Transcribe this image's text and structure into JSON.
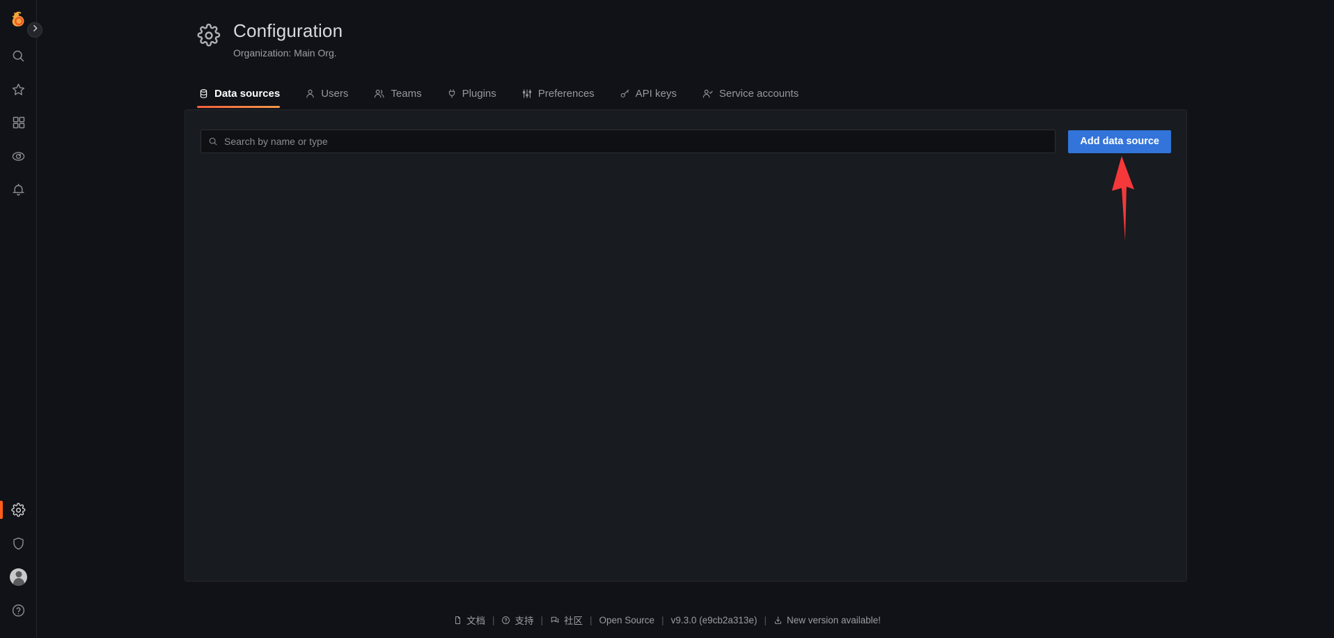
{
  "colors": {
    "page_bg": "#111217",
    "panel_bg": "#181b1f",
    "accent_orange": "#ff5e1a",
    "primary_blue": "#3274d9",
    "annotation_red": "#f5383a",
    "text_primary": "#d8dae0",
    "text_muted": "#9698a0"
  },
  "sidenav": {
    "logo_icon": "grafana-logo-icon",
    "expand_toggle": {
      "icon": "chevron-right-icon",
      "label": "Expand navigation"
    },
    "top_items": [
      {
        "icon": "search-icon",
        "name": "sidebar-item-search",
        "active": false
      },
      {
        "icon": "star-icon",
        "name": "sidebar-item-starred",
        "active": false
      },
      {
        "icon": "dashboards-icon",
        "name": "sidebar-item-dashboards",
        "active": false
      },
      {
        "icon": "compass-icon",
        "name": "sidebar-item-explore",
        "active": false
      },
      {
        "icon": "bell-icon",
        "name": "sidebar-item-alerting",
        "active": false
      }
    ],
    "bottom_items": [
      {
        "icon": "gear-icon",
        "name": "sidebar-item-configuration",
        "active": true
      },
      {
        "icon": "shield-icon",
        "name": "sidebar-item-server-admin",
        "active": false
      },
      {
        "icon": "avatar-icon",
        "name": "sidebar-item-user-profile",
        "active": false
      },
      {
        "icon": "help-circle-icon",
        "name": "sidebar-item-help",
        "active": false
      }
    ]
  },
  "header": {
    "icon": "gear-icon",
    "title": "Configuration",
    "subtitle": "Organization: Main Org."
  },
  "tabs": [
    {
      "label": "Data sources",
      "icon": "database-icon",
      "name": "tab-data-sources",
      "active": true
    },
    {
      "label": "Users",
      "icon": "user-icon",
      "name": "tab-users",
      "active": false
    },
    {
      "label": "Teams",
      "icon": "users-icon",
      "name": "tab-teams",
      "active": false
    },
    {
      "label": "Plugins",
      "icon": "plug-icon",
      "name": "tab-plugins",
      "active": false
    },
    {
      "label": "Preferences",
      "icon": "sliders-icon",
      "name": "tab-preferences",
      "active": false
    },
    {
      "label": "API keys",
      "icon": "key-icon",
      "name": "tab-api-keys",
      "active": false
    },
    {
      "label": "Service accounts",
      "icon": "user-check-icon",
      "name": "tab-service-accounts",
      "active": false
    }
  ],
  "toolbar": {
    "search": {
      "icon": "search-icon",
      "placeholder": "Search by name or type",
      "value": ""
    },
    "add_button_label": "Add data source"
  },
  "datasources_list": {
    "items": [],
    "empty": true
  },
  "annotation": {
    "type": "arrow",
    "color": "#f5383a",
    "points_to": "add-data-source-button"
  },
  "footer": {
    "items": [
      {
        "label": "文档",
        "icon": "document-icon",
        "name": "footer-link-docs"
      },
      {
        "label": "支持",
        "icon": "question-circle-icon",
        "name": "footer-link-support"
      },
      {
        "label": "社区",
        "icon": "comments-icon",
        "name": "footer-link-community"
      },
      {
        "label": "Open Source",
        "icon": "",
        "name": "footer-link-open-source"
      },
      {
        "label": "v9.3.0 (e9cb2a313e)",
        "icon": "",
        "name": "footer-version"
      },
      {
        "label": "New version available!",
        "icon": "download-icon",
        "name": "footer-link-new-version"
      }
    ],
    "separator": "|"
  }
}
